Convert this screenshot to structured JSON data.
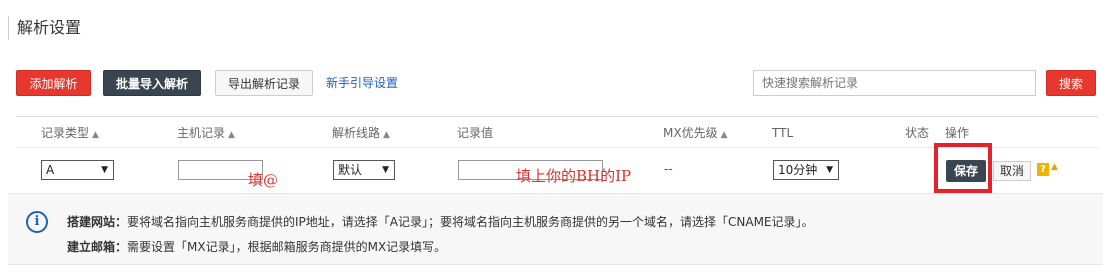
{
  "page": {
    "title": "解析设置"
  },
  "toolbar": {
    "add_label": "添加解析",
    "batch_import_label": "批量导入解析",
    "export_label": "导出解析记录",
    "guide_label": "新手引导设置",
    "search_placeholder": "快速搜索解析记录",
    "search_label": "搜索"
  },
  "table": {
    "headers": {
      "type": "记录类型",
      "host": "主机记录",
      "line": "解析线路",
      "value": "记录值",
      "mx": "MX优先级",
      "ttl": "TTL",
      "status": "状态",
      "action": "操作"
    },
    "sort_glyph": "▲",
    "row": {
      "type": "A",
      "host": "",
      "line": "默认",
      "value": "",
      "mx": "--",
      "ttl": "10分钟",
      "save_label": "保存",
      "cancel_label": "取消",
      "help_glyph": "?",
      "collapse_glyph": "▲"
    }
  },
  "annotations": {
    "host_note": "填@",
    "value_note": "填上你的BH的IP"
  },
  "info": {
    "line1_label": "搭建网站：",
    "line1_text": "要将域名指向主机服务商提供的IP地址，请选择「A记录」；要将域名指向主机服务商提供的另一个域名，请选择「CNAME记录」。",
    "line2_label": "建立邮箱：",
    "line2_text": "需要设置「MX记录」，根据邮箱服务商提供的MX记录填写。"
  },
  "colors": {
    "primary_red": "#e8372f",
    "dark_button": "#3a4552",
    "link_blue": "#1d5fb8",
    "annotation_red": "#d9332b",
    "info_blue": "#1e62b8",
    "help_yellow": "#f0b400"
  }
}
